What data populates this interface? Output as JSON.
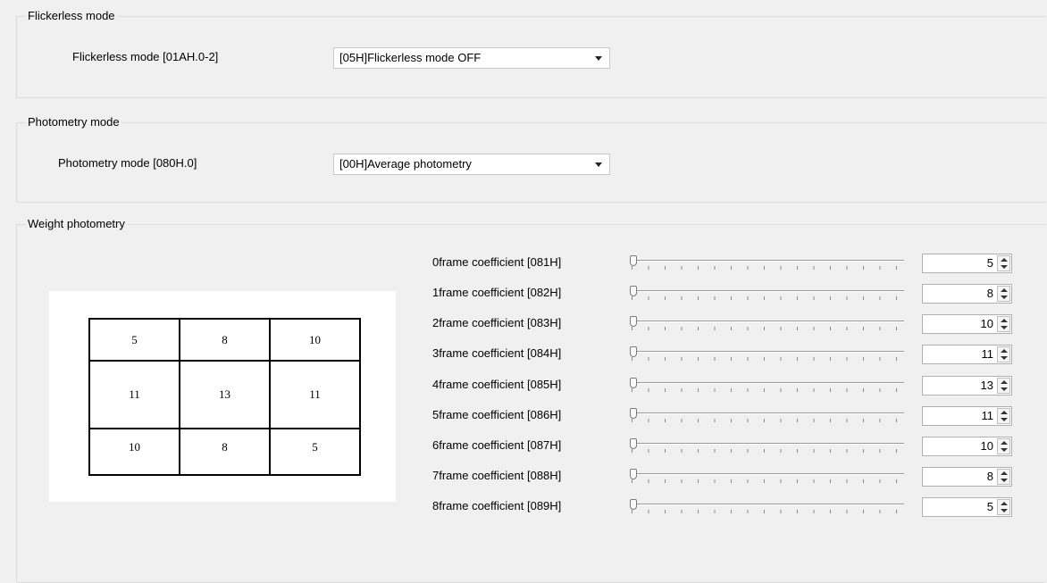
{
  "flickerless": {
    "group_title": "Flickerless mode",
    "label": "Flickerless mode [01AH.0-2]",
    "value": "[05H]Flickerless mode OFF"
  },
  "photometry": {
    "group_title": "Photometry mode",
    "label": "Photometry mode [080H.0]",
    "value": "[00H]Average photometry"
  },
  "weight": {
    "group_title": "Weight photometry",
    "grid": [
      [
        "5",
        "8",
        "10"
      ],
      [
        "11",
        "13",
        "11"
      ],
      [
        "10",
        "8",
        "5"
      ]
    ],
    "coefficients": [
      {
        "label": "0frame coefficient [081H]",
        "value": "5"
      },
      {
        "label": "1frame coefficient [082H]",
        "value": "8"
      },
      {
        "label": "2frame coefficient [083H]",
        "value": "10"
      },
      {
        "label": "3frame coefficient [084H]",
        "value": "11"
      },
      {
        "label": "4frame coefficient [085H]",
        "value": "13"
      },
      {
        "label": "5frame coefficient [086H]",
        "value": "11"
      },
      {
        "label": "6frame coefficient [087H]",
        "value": "10"
      },
      {
        "label": "7frame coefficient [088H]",
        "value": "8"
      },
      {
        "label": "8frame coefficient [089H]",
        "value": "5"
      }
    ]
  }
}
